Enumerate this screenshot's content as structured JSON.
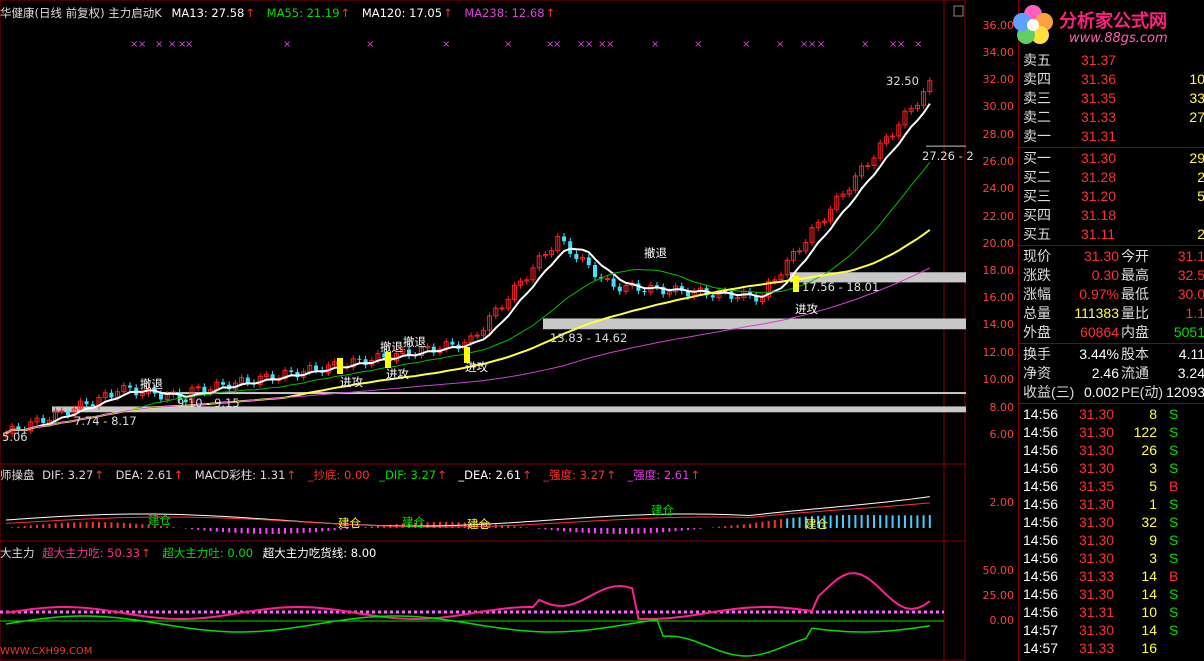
{
  "main_header": {
    "title": "华健康(日线 前复权) 主力启动K",
    "ma13": "MA13: 27.58",
    "ma55": "MA55: 21.19",
    "ma120": "MA120: 17.05",
    "ma238": "MA238: 12.68"
  },
  "macd_header": {
    "title": "师操盘",
    "dif": "DIF: 3.27",
    "dea": "DEA: 2.61",
    "macd": "MACD彩柱: 1.31",
    "chaodi": "_抄底: 0.00",
    "dif2": "_DIF: 3.27",
    "dea2": "_DEA: 2.61",
    "strong1": "_强度: 3.27",
    "strong2": "_强度: 2.61"
  },
  "force_header": {
    "title": "大主力",
    "eat": "超大主力吃: 50.33",
    "spit": "超大主力吐: 0.00",
    "line": "超大主力吃货线: 8.00"
  },
  "annotations": {
    "high": "32.50",
    "r1": "27.26 - 2",
    "zone1": "17.56 - 18.01",
    "zone2": "13.83 - 14.62",
    "zone3": "9.10 - 9.15",
    "zone4": "7.74 - 8.17",
    "low": "5.06",
    "retreat": "撤退",
    "attack": "进攻",
    "build": "建仓",
    "watermark": "WWW.CXH99.COM"
  },
  "price_axis": [
    "36.00",
    "34.00",
    "32.00",
    "30.00",
    "28.00",
    "26.00",
    "24.00",
    "22.00",
    "20.00",
    "18.00",
    "16.00",
    "14.00",
    "12.00",
    "10.00",
    "8.00",
    "6.00"
  ],
  "macd_axis": [
    "2.00"
  ],
  "force_axis": [
    "50.00",
    "25.00",
    "0.00"
  ],
  "logo": {
    "title": "分析家公式网",
    "url": "www.88gs.com"
  },
  "order_book": {
    "asks": [
      {
        "label": "卖五",
        "price": "31.37",
        "vol": ""
      },
      {
        "label": "卖四",
        "price": "31.36",
        "vol": "10"
      },
      {
        "label": "卖三",
        "price": "31.35",
        "vol": "33"
      },
      {
        "label": "卖二",
        "price": "31.33",
        "vol": "27"
      },
      {
        "label": "卖一",
        "price": "31.31",
        "vol": ""
      }
    ],
    "bids": [
      {
        "label": "买一",
        "price": "31.30",
        "vol": "29"
      },
      {
        "label": "买二",
        "price": "31.28",
        "vol": "2"
      },
      {
        "label": "买三",
        "price": "31.20",
        "vol": "5"
      },
      {
        "label": "买四",
        "price": "31.18",
        "vol": ""
      },
      {
        "label": "买五",
        "price": "31.11",
        "vol": "2"
      }
    ]
  },
  "quote": [
    {
      "l1": "现价",
      "v1": "31.30",
      "l2": "今开",
      "v2": "31.1"
    },
    {
      "l1": "涨跌",
      "v1": "0.30",
      "l2": "最高",
      "v2": "32.5"
    },
    {
      "l1": "涨幅",
      "v1": "0.97%",
      "l2": "最低",
      "v2": "30.0"
    },
    {
      "l1": "总量",
      "v1": "111383",
      "l2": "量比",
      "v2": "1.1"
    },
    {
      "l1": "外盘",
      "v1": "60864",
      "l2": "内盘",
      "v2": "5051"
    }
  ],
  "fundamentals": [
    {
      "l1": "换手",
      "v1": "3.44%",
      "l2": "股本",
      "v2": "4.11"
    },
    {
      "l1": "净资",
      "v1": "2.46",
      "l2": "流通",
      "v2": "3.24"
    },
    {
      "l1": "收益(三)",
      "v1": "0.002",
      "l2": "PE(动)",
      "v2": "12093"
    }
  ],
  "ticks": [
    {
      "t": "14:56",
      "p": "31.30",
      "v": "8",
      "s": "S"
    },
    {
      "t": "14:56",
      "p": "31.30",
      "v": "122",
      "s": "S"
    },
    {
      "t": "14:56",
      "p": "31.30",
      "v": "26",
      "s": "S"
    },
    {
      "t": "14:56",
      "p": "31.30",
      "v": "3",
      "s": "S"
    },
    {
      "t": "14:56",
      "p": "31.35",
      "v": "5",
      "s": "B"
    },
    {
      "t": "14:56",
      "p": "31.30",
      "v": "1",
      "s": "S"
    },
    {
      "t": "14:56",
      "p": "31.30",
      "v": "32",
      "s": "S"
    },
    {
      "t": "14:56",
      "p": "31.30",
      "v": "9",
      "s": "S"
    },
    {
      "t": "14:56",
      "p": "31.30",
      "v": "3",
      "s": "S"
    },
    {
      "t": "14:56",
      "p": "31.33",
      "v": "14",
      "s": "B"
    },
    {
      "t": "14:56",
      "p": "31.30",
      "v": "14",
      "s": "S"
    },
    {
      "t": "14:56",
      "p": "31.31",
      "v": "10",
      "s": "S"
    },
    {
      "t": "14:57",
      "p": "31.30",
      "v": "14",
      "s": "S"
    },
    {
      "t": "14:57",
      "p": "31.33",
      "v": "16",
      "s": ""
    }
  ],
  "colors": {
    "up": "#ff2020",
    "down": "#40e0ff",
    "ma13": "#ffffff",
    "ma55": "#00c000",
    "ma120": "#ffff40",
    "ma238": "#d040d0",
    "bg": "#000000"
  }
}
